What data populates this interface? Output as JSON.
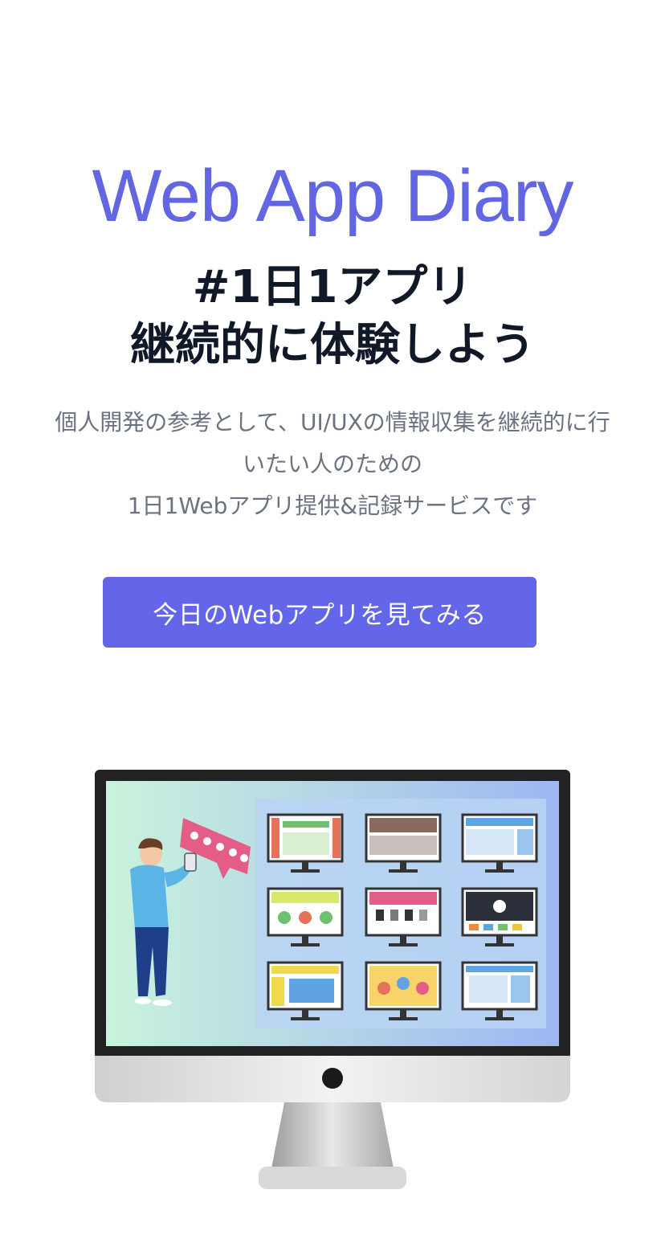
{
  "hero": {
    "title": "Web App Diary",
    "headline_line1": "#1日1アプリ",
    "headline_line2": "継続的に体験しよう",
    "description_line1": "個人開発の参考として、UI/UXの情報収集を継続的に行",
    "description_line2": "いたい人のための",
    "description_line3": "1日1Webアプリ提供&記録サービスです",
    "cta_label": "今日のWebアプリを見てみる"
  },
  "illustration": {
    "name": "monitor-illustration",
    "screen_gradient_start": "#c9f3dc",
    "screen_gradient_end": "#9db7f2",
    "rating_stars": 5
  },
  "colors": {
    "accent": "#6366e8",
    "title": "#6366e1",
    "headline": "#111827",
    "body_text": "#6b7280"
  }
}
